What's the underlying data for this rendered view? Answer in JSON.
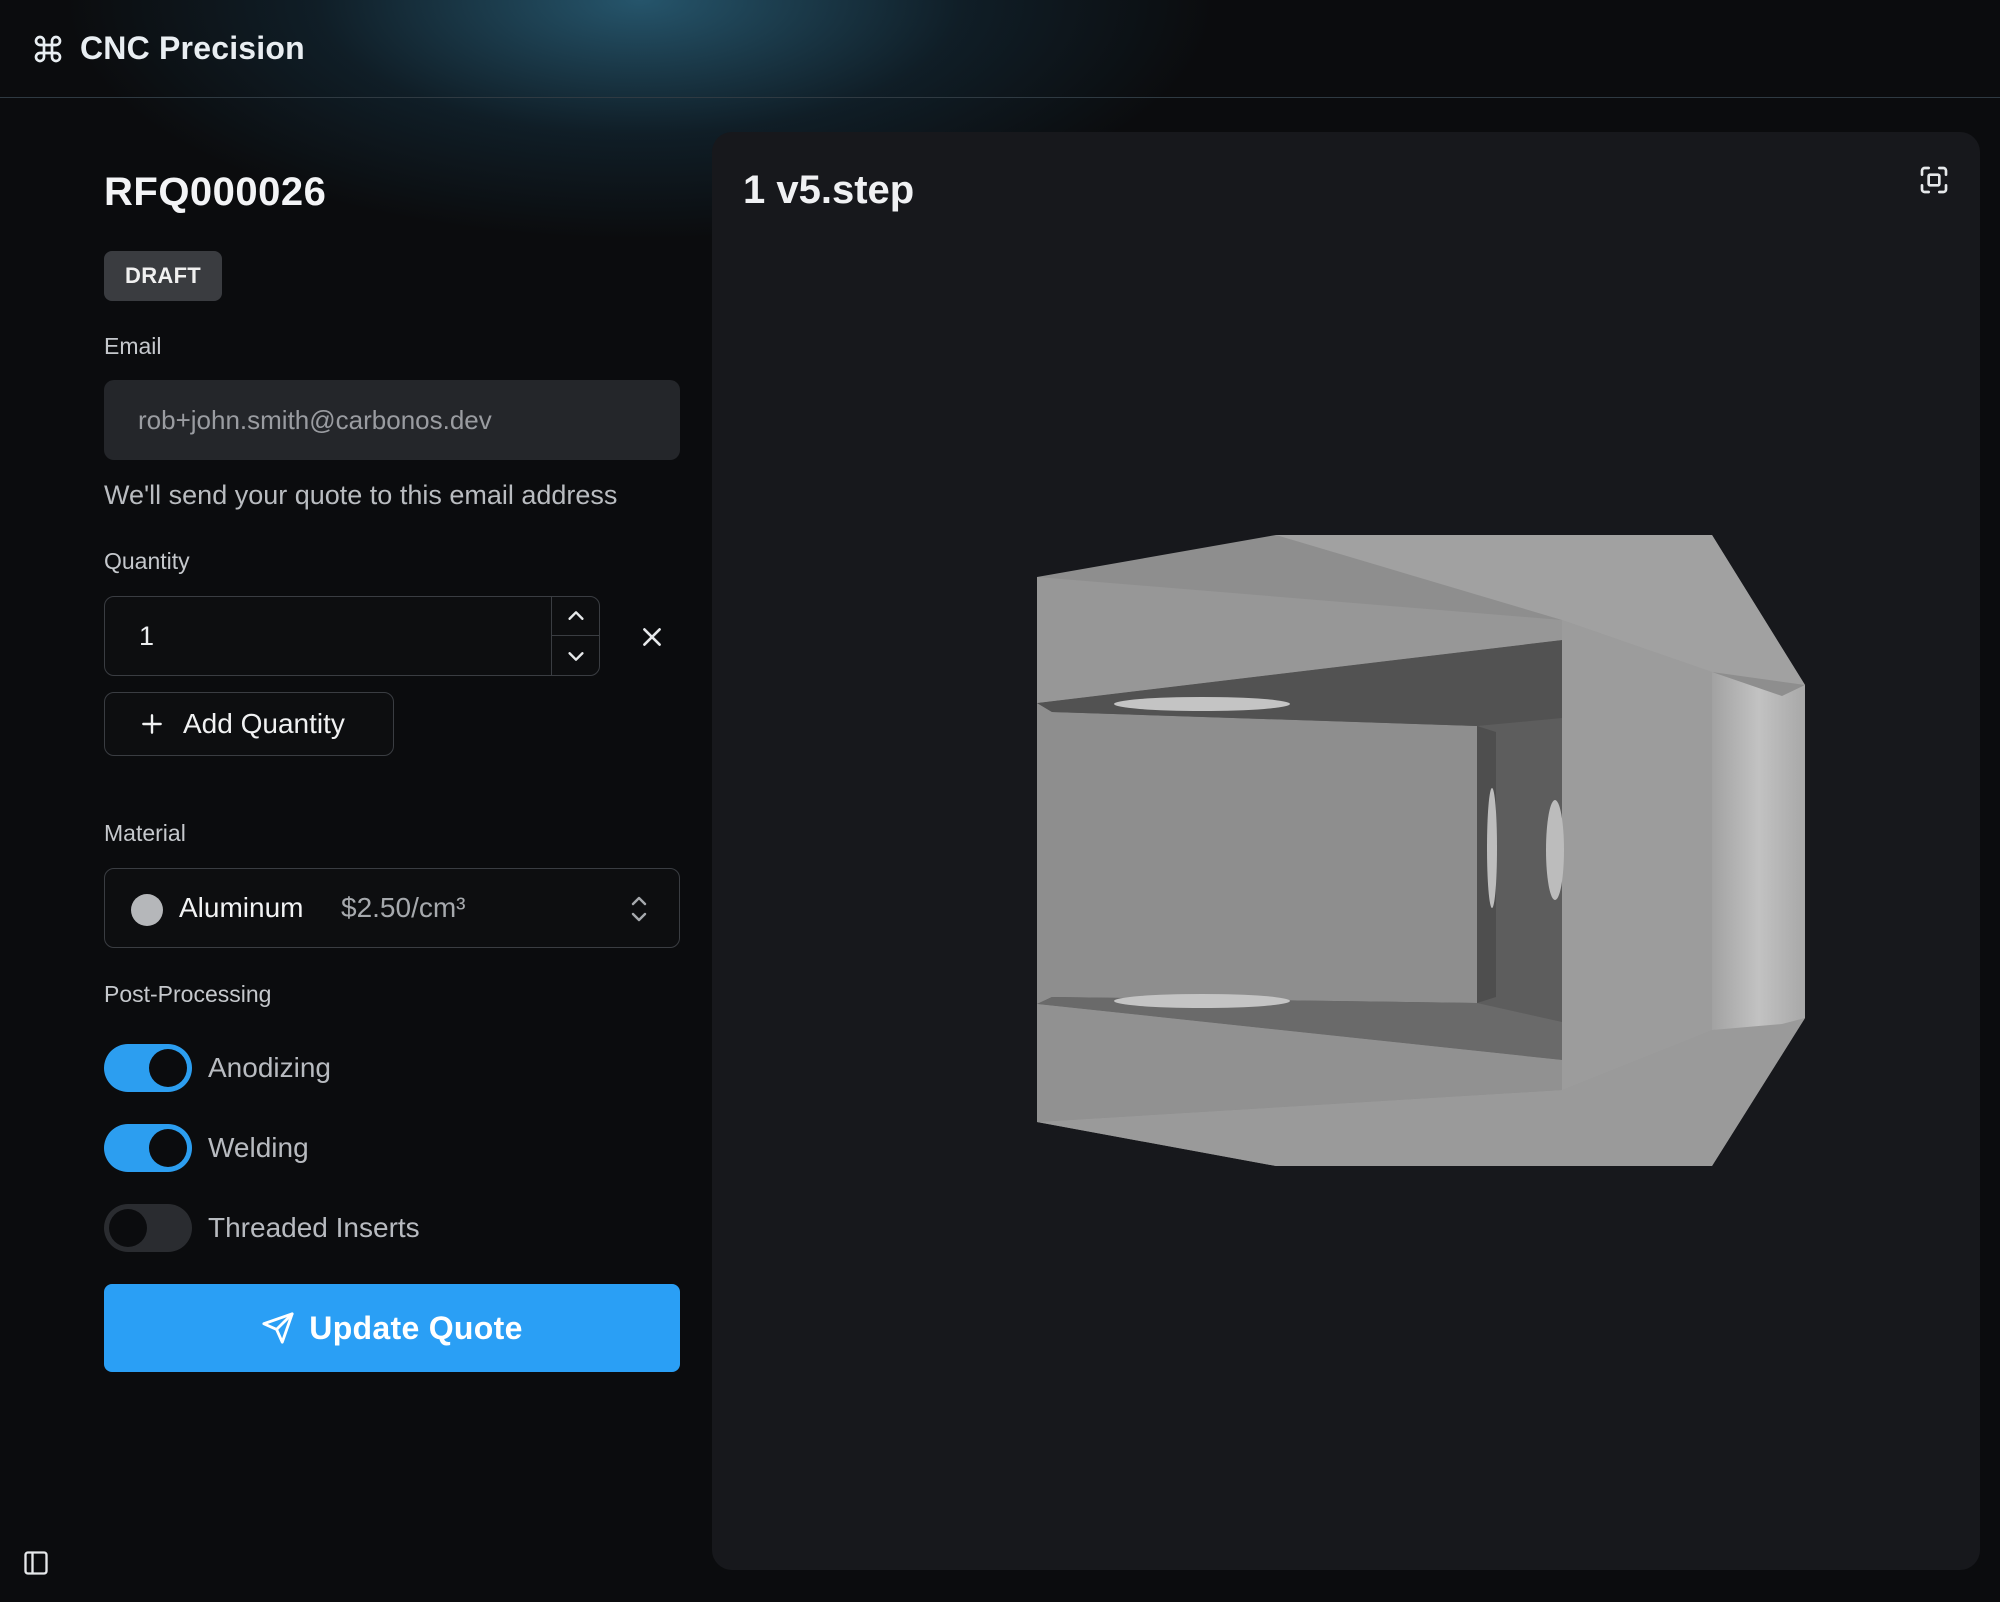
{
  "header": {
    "app_name": "CNC Precision",
    "icon": "command-icon"
  },
  "quote": {
    "id": "RFQ000026",
    "status": "DRAFT",
    "email": {
      "label": "Email",
      "value": "rob+john.smith@carbonos.dev",
      "helper": "We'll send your quote to this email address"
    },
    "quantity": {
      "label": "Quantity",
      "value": "1",
      "add_label": "Add Quantity"
    },
    "material": {
      "label": "Material",
      "name": "Aluminum",
      "price": "$2.50/cm³",
      "swatch_color": "#b5b7ba"
    },
    "post_processing": {
      "label": "Post-Processing",
      "options": [
        {
          "label": "Anodizing",
          "enabled": true
        },
        {
          "label": "Welding",
          "enabled": true
        },
        {
          "label": "Threaded Inserts",
          "enabled": false
        }
      ]
    },
    "submit_label": "Update Quote"
  },
  "viewer": {
    "file_name": "1 v5.step"
  },
  "colors": {
    "accent": "#2a9ff5",
    "toggle_on": "#2c9ef0",
    "panel": "#17181c",
    "background": "#0b0c0e"
  }
}
